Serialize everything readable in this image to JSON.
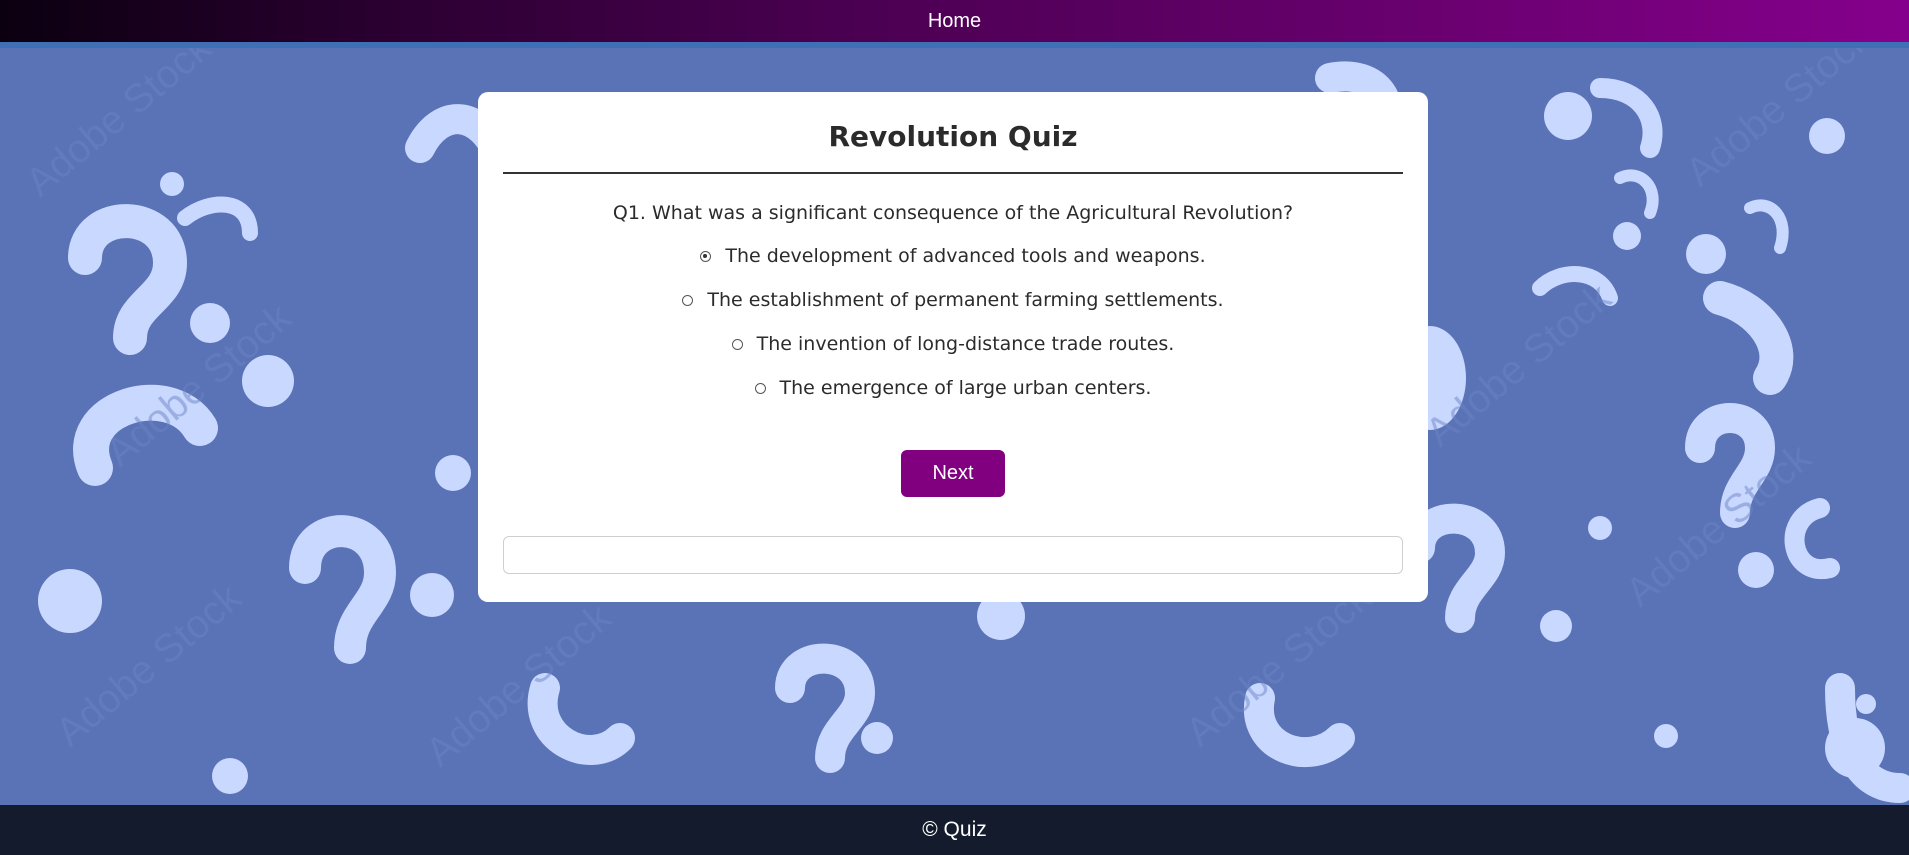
{
  "nav": {
    "home_label": "Home"
  },
  "quiz": {
    "title": "Revolution Quiz",
    "question": "Q1. What was a significant consequence of the Agricultural Revolution?",
    "options": [
      {
        "label": "The development of advanced tools and weapons.",
        "selected": true
      },
      {
        "label": "The establishment of permanent farming settlements.",
        "selected": false
      },
      {
        "label": "The invention of long-distance trade routes.",
        "selected": false
      },
      {
        "label": "The emergence of large urban centers.",
        "selected": false
      }
    ],
    "next_label": "Next",
    "result_text": ""
  },
  "footer": {
    "text": "© Quiz"
  },
  "colors": {
    "nav_gradient_start": "#0b0010",
    "nav_gradient_end": "#85008c",
    "background": "#5a72b6",
    "question_mark_shapes": "#c9d8ff",
    "accent_button": "#800080",
    "footer_bg": "#111827"
  },
  "icons": {
    "background_pattern": "question-mark-pattern",
    "radio": "radio-button"
  }
}
